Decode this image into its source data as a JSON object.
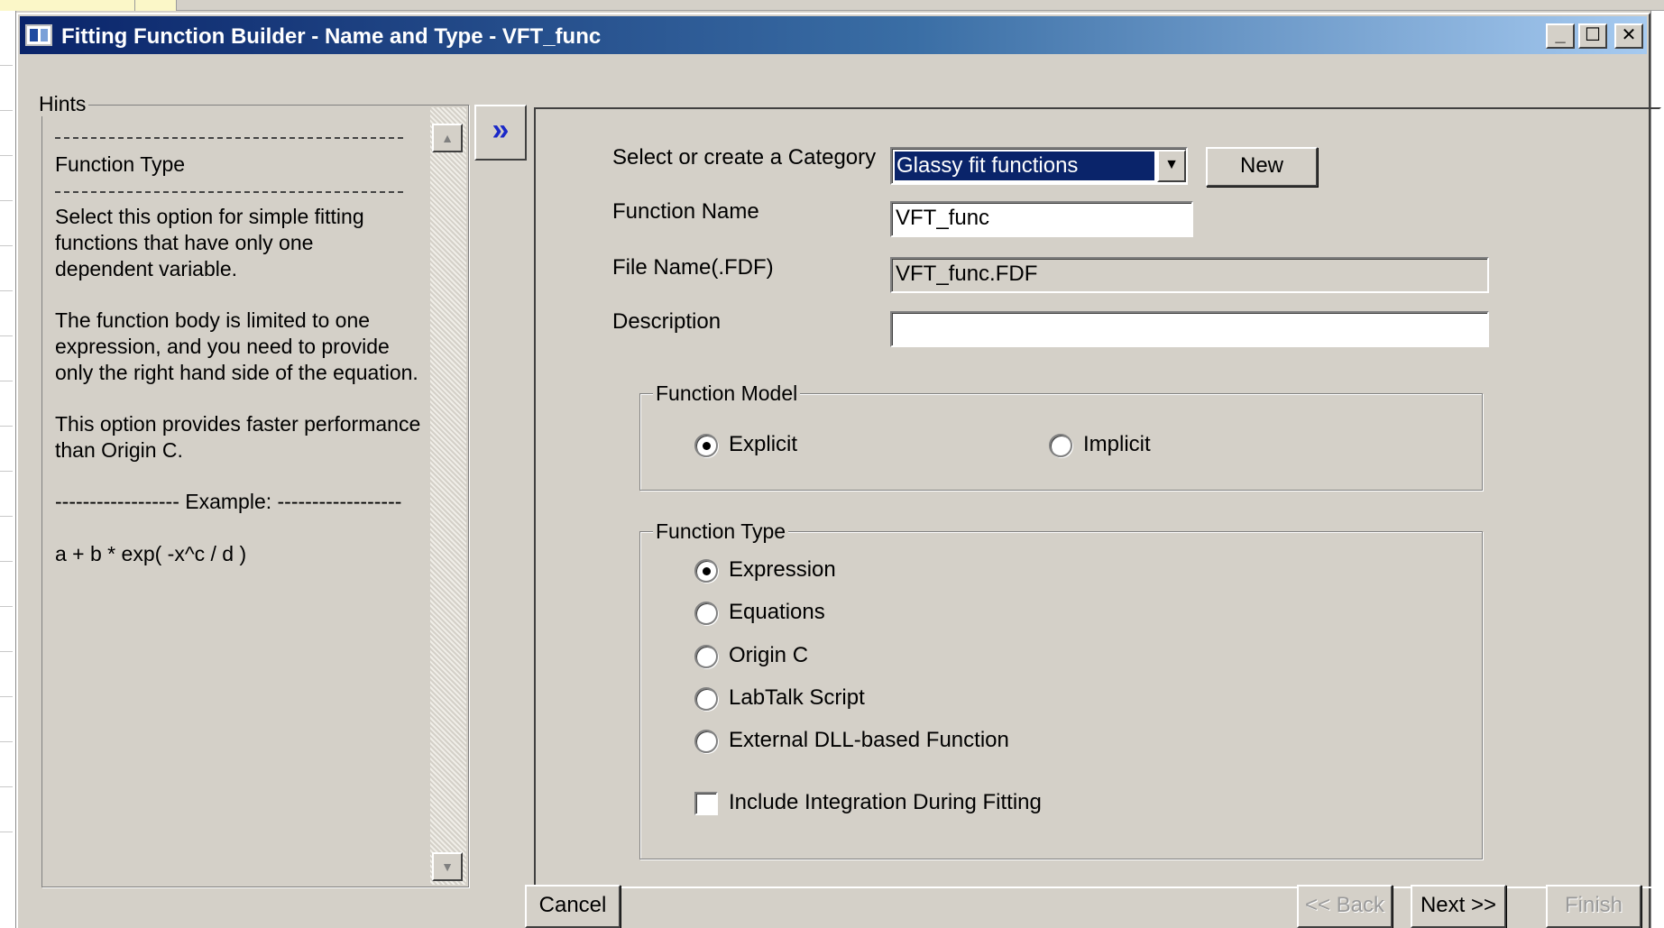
{
  "window": {
    "title": "Fitting Function Builder - Name and Type - VFT_func",
    "minimize_glyph": "_",
    "maximize_glyph": "☐",
    "close_glyph": "✕"
  },
  "hints": {
    "legend": "Hints",
    "heading": "Function Type",
    "para1": [
      "Select this option for simple fitting",
      "functions that have only one",
      "dependent variable."
    ],
    "para2": [
      "The function body is limited to one",
      "expression, and you need to provide",
      "only the right hand side of the equation."
    ],
    "para3": [
      "This option provides faster performance",
      "than Origin C."
    ],
    "example_label": "------------------ Example: ------------------",
    "example_expr": "a + b * exp( -x^c / d )"
  },
  "expand_glyph": "»",
  "form": {
    "category_label": "Select or create a Category",
    "category_value": "Glassy fit functions",
    "new_button": "New",
    "function_name_label": "Function Name",
    "function_name_value": "VFT_func",
    "file_name_label": "File Name(.FDF)",
    "file_name_value": "VFT_func.FDF",
    "description_label": "Description",
    "description_value": ""
  },
  "function_model": {
    "legend": "Function Model",
    "options": [
      {
        "label": "Explicit",
        "checked": true
      },
      {
        "label": "Implicit",
        "checked": false
      }
    ]
  },
  "function_type": {
    "legend": "Function Type",
    "options": [
      {
        "label": "Expression",
        "checked": true
      },
      {
        "label": "Equations",
        "checked": false
      },
      {
        "label": "Origin C",
        "checked": false
      },
      {
        "label": "LabTalk Script",
        "checked": false
      },
      {
        "label": "External DLL-based Function",
        "checked": false
      }
    ],
    "include_integration_label": "Include Integration During Fitting",
    "include_integration_checked": false
  },
  "buttons": {
    "cancel": "Cancel",
    "back": "<< Back",
    "next": "Next >>",
    "finish": "Finish"
  }
}
